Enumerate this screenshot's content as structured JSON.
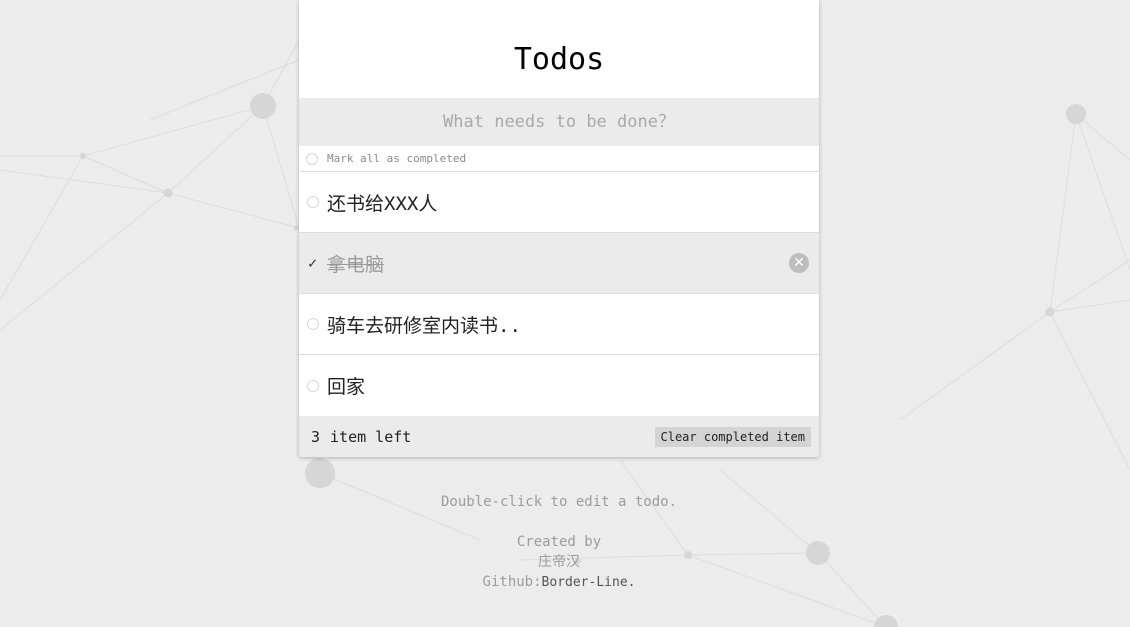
{
  "app": {
    "title": "Todos",
    "new_todo_placeholder": "What needs to be done？",
    "toggle_all_label": "Mark all as completed"
  },
  "todos": [
    {
      "text": "还书给XXX人",
      "completed": false
    },
    {
      "text": "拿电脑",
      "completed": true
    },
    {
      "text": "骑车去研修室内读书..",
      "completed": false
    },
    {
      "text": "回家",
      "completed": false
    }
  ],
  "footer": {
    "count": "3",
    "count_label": "item left",
    "clear_completed_label": "Clear completed item"
  },
  "info": {
    "hint": "Double-click to edit a todo.",
    "created_by_label": "Created by",
    "author": "庄帝汉",
    "github_label": "Github:",
    "github_link": "Border-Line."
  },
  "icons": {
    "check": "check-icon",
    "destroy": "close-icon",
    "circle": "circle-icon"
  },
  "colors": {
    "background": "#ececec",
    "panel": "#ffffff",
    "input_bg": "#ebebeb",
    "completed_text": "#9a9a9a",
    "destroy_bg": "#bdbdbd"
  }
}
